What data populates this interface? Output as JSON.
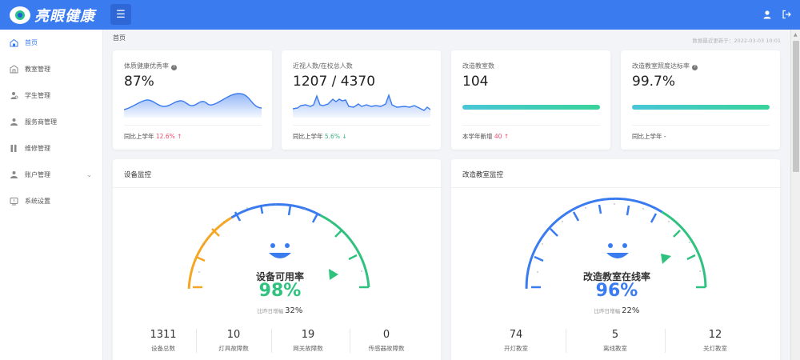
{
  "app": {
    "logo_text": "亮眼健康"
  },
  "sidebar": {
    "items": [
      {
        "label": "首页",
        "icon": "home-icon"
      },
      {
        "label": "教室管理",
        "icon": "building-icon"
      },
      {
        "label": "学生管理",
        "icon": "student-icon"
      },
      {
        "label": "服务商管理",
        "icon": "provider-icon"
      },
      {
        "label": "维修管理",
        "icon": "wrench-icon"
      },
      {
        "label": "账户管理",
        "icon": "account-icon"
      },
      {
        "label": "系统设置",
        "icon": "settings-icon"
      }
    ]
  },
  "breadcrumb": "首页",
  "updated_text": "数据最近更新于：2022-03-03 10:01",
  "stats": [
    {
      "label": "体质健康优秀率",
      "value": "87%",
      "foot_prefix": "同比上学年",
      "foot_value": "12.6% ↑"
    },
    {
      "label": "近视人数/在校总人数",
      "value": "1207 / 4370",
      "foot_prefix": "同比上学年",
      "foot_value": "5.6% ↓"
    },
    {
      "label": "改造教室数",
      "value": "104",
      "foot_prefix": "本学年新增",
      "foot_value": "40 ↑"
    },
    {
      "label": "改造教室照度达标率",
      "value": "99.7%",
      "foot_prefix": "同比上学年",
      "foot_value": "-"
    }
  ],
  "panels": {
    "device": {
      "title": "设备监控",
      "gauge_title": "设备可用率",
      "gauge_value": "98%",
      "gauge_level": 0.98,
      "compare_label": "比昨日增幅",
      "compare_value": "32%",
      "metrics": [
        {
          "value": "1311",
          "label": "设备总数"
        },
        {
          "value": "10",
          "label": "灯具故障数"
        },
        {
          "value": "19",
          "label": "网关故障数"
        },
        {
          "value": "0",
          "label": "传感器故障数"
        }
      ]
    },
    "classroom": {
      "title": "改造教室监控",
      "gauge_title": "改造教室在线率",
      "gauge_value": "96%",
      "gauge_level": 0.96,
      "compare_label": "比昨日增幅",
      "compare_value": "22%",
      "metrics": [
        {
          "value": "74",
          "label": "开灯教室"
        },
        {
          "value": "5",
          "label": "离线教室"
        },
        {
          "value": "12",
          "label": "关灯教室"
        }
      ]
    }
  },
  "colors": {
    "primary": "#3a7bf0",
    "green": "#2ec27e",
    "orange": "#f5a623",
    "red": "#e84d6a"
  }
}
